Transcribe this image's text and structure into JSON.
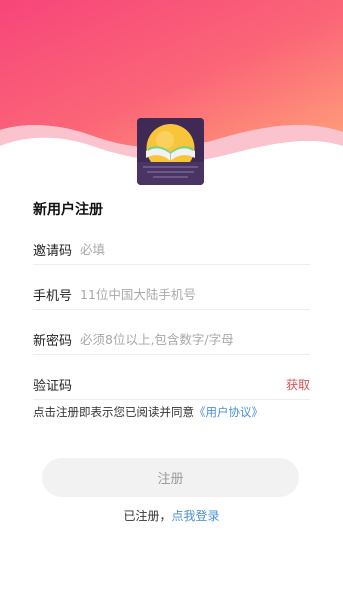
{
  "page_title": "新用户注册",
  "logo": {
    "icon": "open-book-sunset-icon",
    "colors": {
      "bg": "#3f2a55",
      "sun": "#f7c43a"
    }
  },
  "fields": {
    "invite_code": {
      "label": "邀请码",
      "placeholder": "必填",
      "value": ""
    },
    "phone": {
      "label": "手机号",
      "placeholder": "11位中国大陆手机号",
      "value": ""
    },
    "password": {
      "label": "新密码",
      "placeholder": "必须8位以上,包含数字/字母",
      "value": ""
    },
    "verify_code": {
      "label": "验证码",
      "placeholder": "",
      "value": "",
      "action_label": "获取"
    }
  },
  "agreement": {
    "text": "点击注册即表示您已阅读并同意",
    "link_label": "《用户协议》"
  },
  "register_button": {
    "label": "注册"
  },
  "login": {
    "text": "已注册，",
    "link_label": "点我登录"
  },
  "colors": {
    "header_gradient_start": "#f7457a",
    "header_gradient_end": "#ffa07a",
    "link": "#4a8fd6",
    "get_code": "#d9534f"
  }
}
